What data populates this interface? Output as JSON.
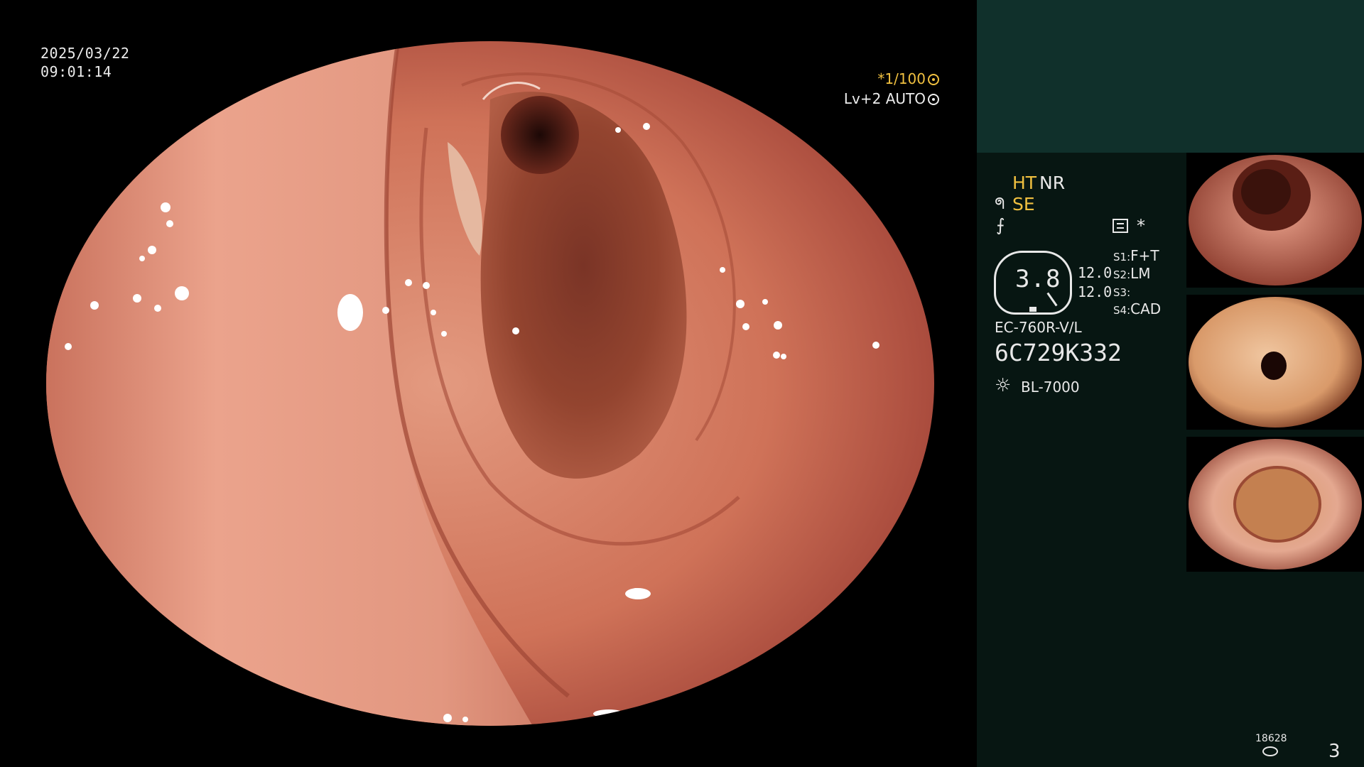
{
  "osd": {
    "date": "2025/03/22",
    "time": "09:01:14",
    "shutter": "*1/100",
    "level": "Lv+2 AUTO"
  },
  "panel": {
    "mode_ht": "HT",
    "mode_nr": "NR",
    "mode_se": "SE",
    "se_icon": "ᖗ",
    "freeze_icon": "⨍",
    "star": "*",
    "zoom": "3.8",
    "val1": "12.0",
    "val2": "12.0",
    "slots": [
      {
        "key": "S1:",
        "value": "F+T"
      },
      {
        "key": "S2:",
        "value": "LM"
      },
      {
        "key": "S3:",
        "value": ""
      },
      {
        "key": "S4:",
        "value": "CAD"
      }
    ],
    "scope_model": "EC-760R-V/L",
    "serial": "6C729K332",
    "light_icon": "☼",
    "light_source": "BL-7000",
    "image_counter": "18628",
    "page_number": "3"
  },
  "icons": {
    "shutter_icon": "aperture-icon",
    "level_icon": "iris-icon",
    "menu_icon": "menu-icon",
    "light_icon": "sun-icon",
    "disk_icon": "storage-icon"
  },
  "colors": {
    "accent_yellow": "#f0c040",
    "panel_bg": "#071612",
    "panel_top": "#10302b",
    "mucosa": "#c0604a"
  }
}
